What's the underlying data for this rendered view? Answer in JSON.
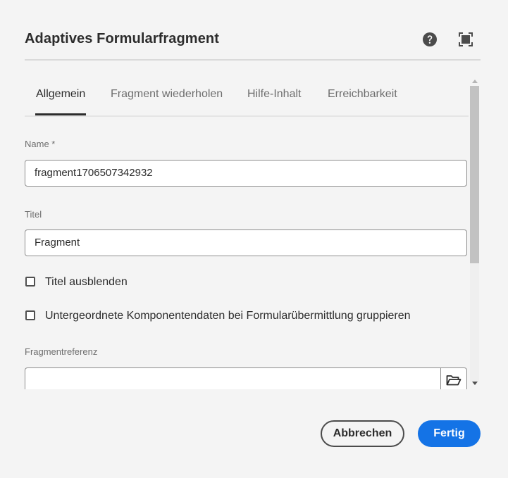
{
  "dialog": {
    "title": "Adaptives Formularfragment"
  },
  "tabs": [
    {
      "label": "Allgemein",
      "active": true
    },
    {
      "label": "Fragment wiederholen",
      "active": false
    },
    {
      "label": "Hilfe-Inhalt",
      "active": false
    },
    {
      "label": "Erreichbarkeit",
      "active": false
    }
  ],
  "fields": {
    "name": {
      "label": "Name *",
      "value": "fragment1706507342932"
    },
    "title": {
      "label": "Titel",
      "value": "Fragment"
    },
    "hide_title": {
      "label": "Titel ausblenden",
      "checked": false
    },
    "group_data": {
      "label": "Untergeordnete Komponentendaten bei Formularübermittlung gruppieren",
      "checked": false
    },
    "fragment_ref": {
      "label": "Fragmentreferenz",
      "value": ""
    }
  },
  "footer": {
    "cancel_label": "Abbrechen",
    "done_label": "Fertig"
  },
  "icons": {
    "help": "help-icon",
    "fullscreen": "fullscreen-icon",
    "folder": "folder-icon"
  },
  "colors": {
    "accent": "#1473e6",
    "background": "#f4f4f4"
  }
}
